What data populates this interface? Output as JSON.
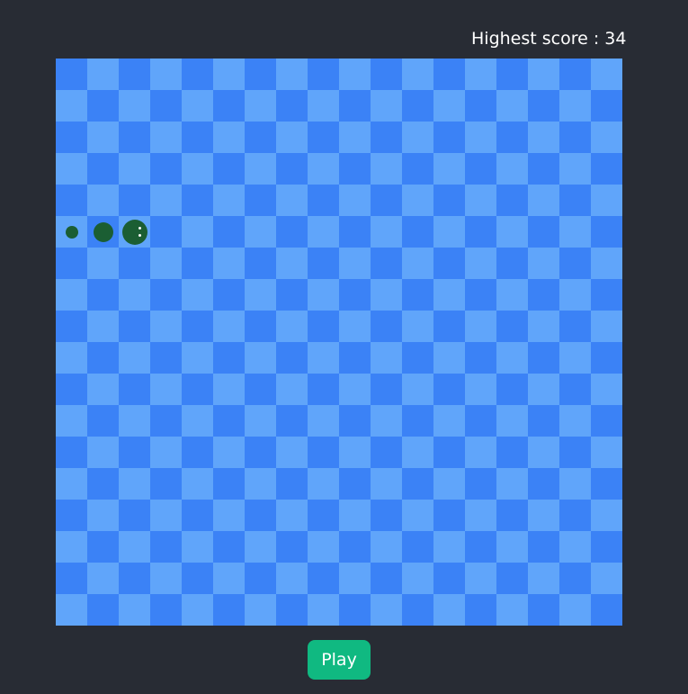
{
  "header": {
    "highest_score_text": "Highest score : 34"
  },
  "board": {
    "columns": 18,
    "rows": 18,
    "colors": {
      "dark": "#3b82f6",
      "light": "#60a5fa",
      "snake": "#1b5e33",
      "eye": "#ffffff"
    }
  },
  "snake": {
    "direction": "right",
    "segments": [
      {
        "col": 0,
        "row": 5,
        "part": "tail"
      },
      {
        "col": 1,
        "row": 5,
        "part": "body"
      },
      {
        "col": 2,
        "row": 5,
        "part": "head"
      }
    ]
  },
  "controls": {
    "play_label": "Play",
    "play_color": "#10b981"
  }
}
